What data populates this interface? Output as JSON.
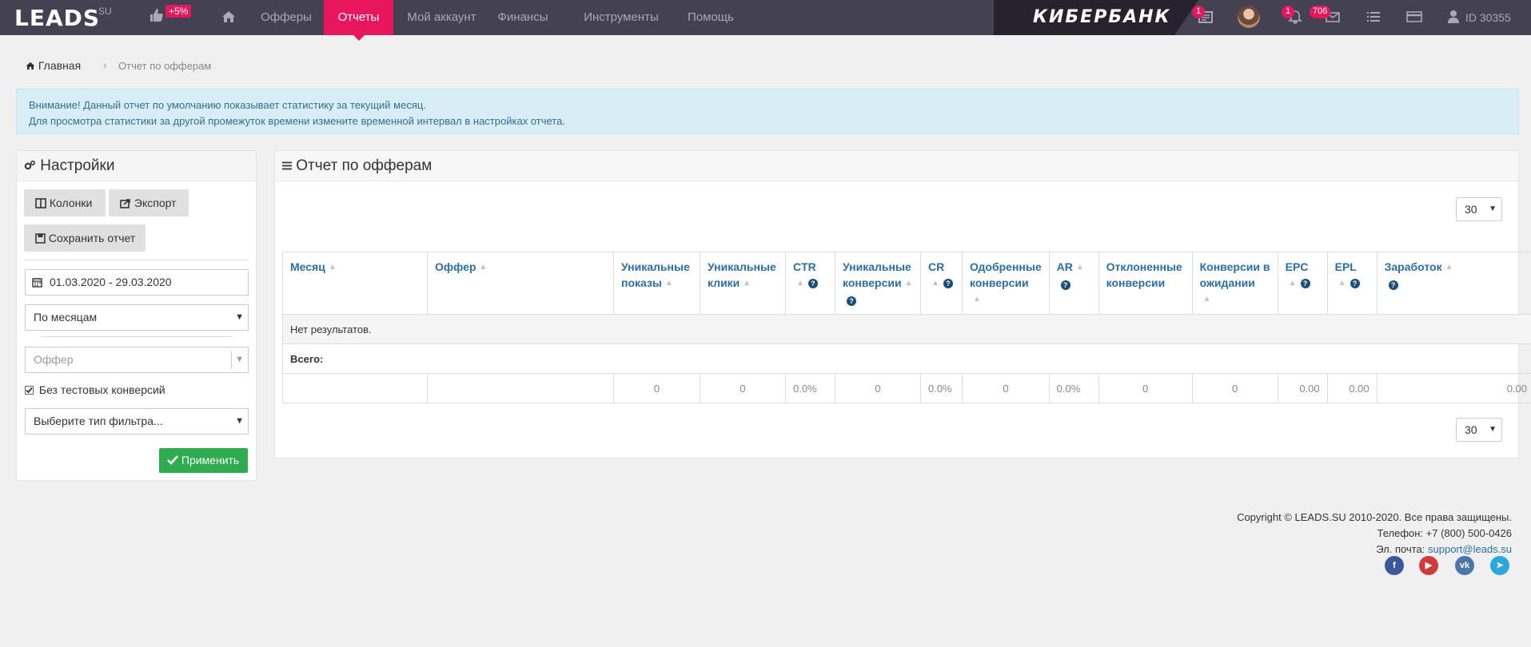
{
  "topbar": {
    "logo": "LEADS",
    "logo_suffix": "SU",
    "promo_badge": "+5%",
    "nav": [
      {
        "label": "Офферы",
        "active": false
      },
      {
        "label": "Отчеты",
        "active": true
      },
      {
        "label": "Мой аккаунт",
        "active": false
      },
      {
        "label": "Финансы",
        "active": false
      },
      {
        "label": "Инструменты",
        "active": false
      },
      {
        "label": "Помощь",
        "active": false
      }
    ],
    "banner_text": "КИБЕРБАНК",
    "news_badge": "1",
    "notifications_badge": "1",
    "messages_badge": "706",
    "user_id": "ID 30355",
    "colors": {
      "bar": "#434152",
      "accent": "#e8175d"
    }
  },
  "breadcrumb": {
    "home": "Главная",
    "separator": "›",
    "current": "Отчет по офферам"
  },
  "alert": {
    "line1": "Внимание! Данный отчет по умолчанию показывает статистику за текущий месяц.",
    "line2": "Для просмотра статистики за другой промежуток времени измените временной интервал в настройках отчета."
  },
  "settings": {
    "title": "Настройки",
    "columns_button": "Колонки",
    "export_button": "Экспорт",
    "save_button": "Сохранить отчет",
    "date_range": "01.03.2020 - 29.03.2020",
    "grouping": "По месяцам",
    "offer_placeholder": "Оффер",
    "exclude_test_label": "Без тестовых конверсий",
    "exclude_test_checked": true,
    "filter_type": "Выберите тип фильтра...",
    "apply_button": "Применить"
  },
  "report": {
    "title": "Отчет по офферам",
    "page_size": "30",
    "columns": [
      {
        "label": "Месяц",
        "sort": true,
        "help": false
      },
      {
        "label": "Оффер",
        "sort": true,
        "help": false
      },
      {
        "label": "Уникальные показы",
        "sort": true,
        "help": false
      },
      {
        "label": "Уникальные клики",
        "sort": true,
        "help": false
      },
      {
        "label": "CTR",
        "sort": true,
        "help": true
      },
      {
        "label": "Уникальные конверсии",
        "sort": true,
        "help": true
      },
      {
        "label": "CR",
        "sort": true,
        "help": true
      },
      {
        "label": "Одобренные конверсии",
        "sort": true,
        "help": false
      },
      {
        "label": "AR",
        "sort": true,
        "help": true
      },
      {
        "label": "Отклоненные конверсии",
        "sort": true,
        "help": false
      },
      {
        "label": "Конверсии в ожидании",
        "sort": true,
        "help": false
      },
      {
        "label": "EPC",
        "sort": true,
        "help": true
      },
      {
        "label": "EPL",
        "sort": true,
        "help": true
      },
      {
        "label": "Заработок",
        "sort": true,
        "help": true
      }
    ],
    "no_results": "Нет результатов.",
    "total_label": "Всего:",
    "totals": [
      "",
      "",
      "0",
      "0",
      "0.0%",
      "0",
      "0.0%",
      "0",
      "0.0%",
      "0",
      "0",
      "0.00",
      "0.00",
      "0.00"
    ]
  },
  "footer": {
    "copyright": "Copyright © LEADS.SU 2010-2020. Все права защищены.",
    "phone": "Телефон: +7 (800) 500-0426",
    "email_label": "Эл. почта: ",
    "email": "support@leads.su",
    "social": [
      "facebook-icon",
      "youtube-icon",
      "vk-icon",
      "telegram-icon"
    ]
  }
}
